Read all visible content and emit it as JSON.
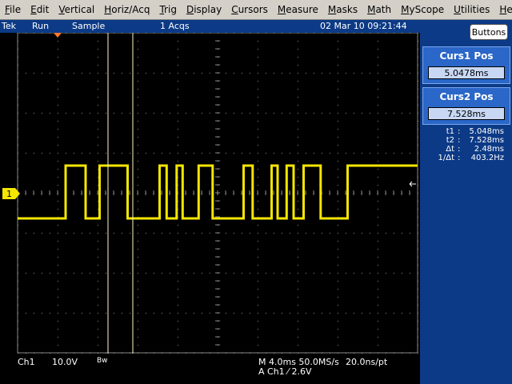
{
  "menu": [
    {
      "ul": "F",
      "rest": "ile"
    },
    {
      "ul": "E",
      "rest": "dit"
    },
    {
      "ul": "V",
      "rest": "ertical"
    },
    {
      "ul": "H",
      "rest": "oriz/Acq"
    },
    {
      "ul": "T",
      "rest": "rig"
    },
    {
      "ul": "D",
      "rest": "isplay"
    },
    {
      "ul": "C",
      "rest": "ursors"
    },
    {
      "ul": "M",
      "rest": "easure"
    },
    {
      "ul": "M",
      "rest": "asks"
    },
    {
      "ul": "M",
      "rest": "ath"
    },
    {
      "ul": "M",
      "rest": "yScope"
    },
    {
      "ul": "U",
      "rest": "tilities"
    },
    {
      "ul": "H",
      "rest": "elp"
    }
  ],
  "status": {
    "brand": "Tek",
    "run": "Run",
    "mode": "Sample",
    "acqs": "1 Acqs",
    "datetime": "02 Mar 10 09:21:44"
  },
  "buttons_label": "Buttons",
  "cursor1": {
    "title": "Curs1 Pos",
    "value": "5.0478ms"
  },
  "cursor2": {
    "title": "Curs2 Pos",
    "value": "7.528ms"
  },
  "readout": [
    {
      "label": "t1",
      "value": "5.048ms"
    },
    {
      "label": "t2",
      "value": "7.528ms"
    },
    {
      "label": "Δt",
      "value": "2.48ms"
    },
    {
      "label": "1/Δt",
      "value": "403.2Hz"
    }
  ],
  "bottom": {
    "channel": "Ch1",
    "scale": "10.0V",
    "bw": "Bw",
    "timebase": "M 4.0ms 50.0MS/s",
    "resolution": "20.0ns/pt",
    "trigger": "A Ch1 ⁄ 2.6V"
  },
  "ch1_marker": "1",
  "colors": {
    "trace": "#f5e600",
    "grid": "#8a8a8a",
    "panel": "#0c3a86",
    "cursor": "#fff8c0",
    "trigger_marker": "#ff7a2a"
  },
  "waveform_edges_ms": [
    0,
    4.8,
    6.8,
    8.2,
    11.0,
    14.2,
    14.9,
    15.9,
    16.5,
    18.1,
    19.5,
    22.6,
    23.5,
    25.4,
    26.0,
    26.9,
    27.6,
    28.6,
    30.3,
    33.0,
    40.0
  ]
}
